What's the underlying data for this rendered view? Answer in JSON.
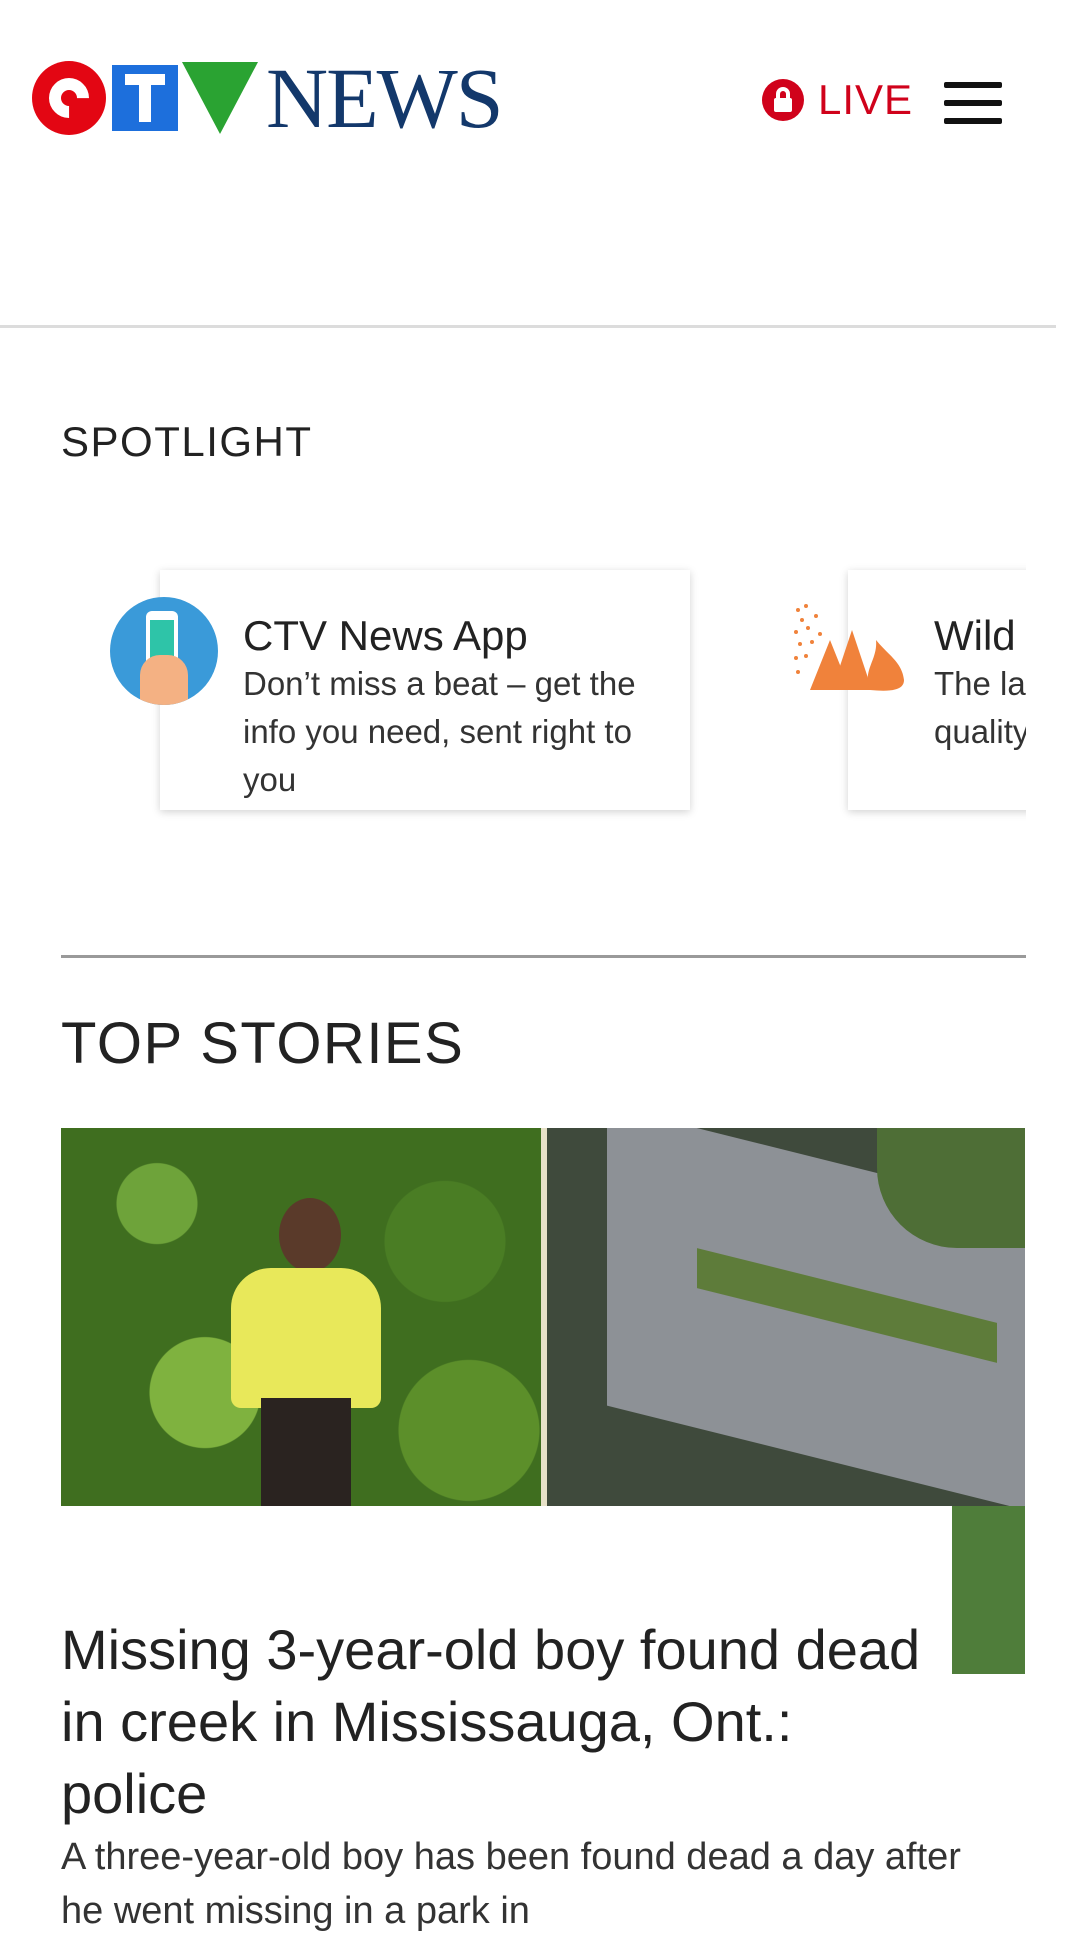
{
  "header": {
    "logo_wordmark": "NEWS",
    "logo_brand": "CTV",
    "live_label": "LIVE",
    "live_color": "#d0021b"
  },
  "spotlight": {
    "title": "SPOTLIGHT",
    "cards": [
      {
        "title": "CTV News App",
        "text": "Don’t miss a beat – get the info you need, sent right to you",
        "icon": "phone-hand-icon"
      },
      {
        "title": "Wild",
        "text": "The la quality",
        "icon": "wildfire-icon"
      }
    ]
  },
  "top_stories": {
    "title": "TOP STORIES",
    "lead": {
      "headline": "Missing 3-year-old boy found dead in creek in Mississauga, Ont.: police",
      "summary": "A three-year-old boy has been found dead a day after he went missing in a park in"
    }
  }
}
